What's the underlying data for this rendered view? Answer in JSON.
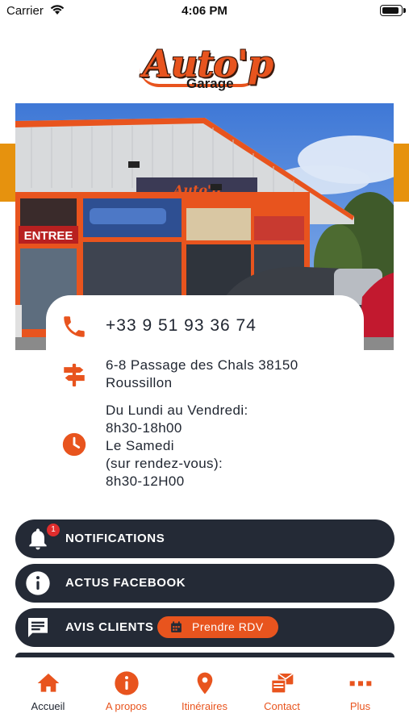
{
  "status_bar": {
    "carrier": "Carrier",
    "time": "4:06 PM"
  },
  "logo": {
    "main": "Auto'p",
    "sub": "Garage"
  },
  "hero": {
    "sign_entree": "ENTREE",
    "sign_shop": "Auto'p"
  },
  "contact": {
    "phone": "+33 9 51 93 36 74",
    "address_line1": "6-8 Passage des Chals 38150",
    "address_line2": "Roussillon",
    "hours_line1": "Du Lundi au Vendredi:",
    "hours_line2": "8h30-18h00",
    "hours_line3": "Le Samedi",
    "hours_line4": "(sur rendez-vous):",
    "hours_line5": "8h30-12H00"
  },
  "menu": {
    "notifications_label": "NOTIFICATIONS",
    "notifications_badge": "1",
    "facebook_label": "ACTUS FACEBOOK",
    "reviews_label": "AVIS CLIENTS",
    "rdv_label": "Prendre RDV"
  },
  "tabs": [
    {
      "label": "Accueil",
      "icon": "home-icon",
      "active": true
    },
    {
      "label": "A propos",
      "icon": "info-icon",
      "active": false
    },
    {
      "label": "Itinéraires",
      "icon": "map-pin-icon",
      "active": false
    },
    {
      "label": "Contact",
      "icon": "mail-icon",
      "active": false
    },
    {
      "label": "Plus",
      "icon": "more-icon",
      "active": false
    }
  ],
  "colors": {
    "accent": "#e8541e",
    "dark_button": "#242a36",
    "side_tab": "#e6920e",
    "badge": "#e02d2d"
  }
}
